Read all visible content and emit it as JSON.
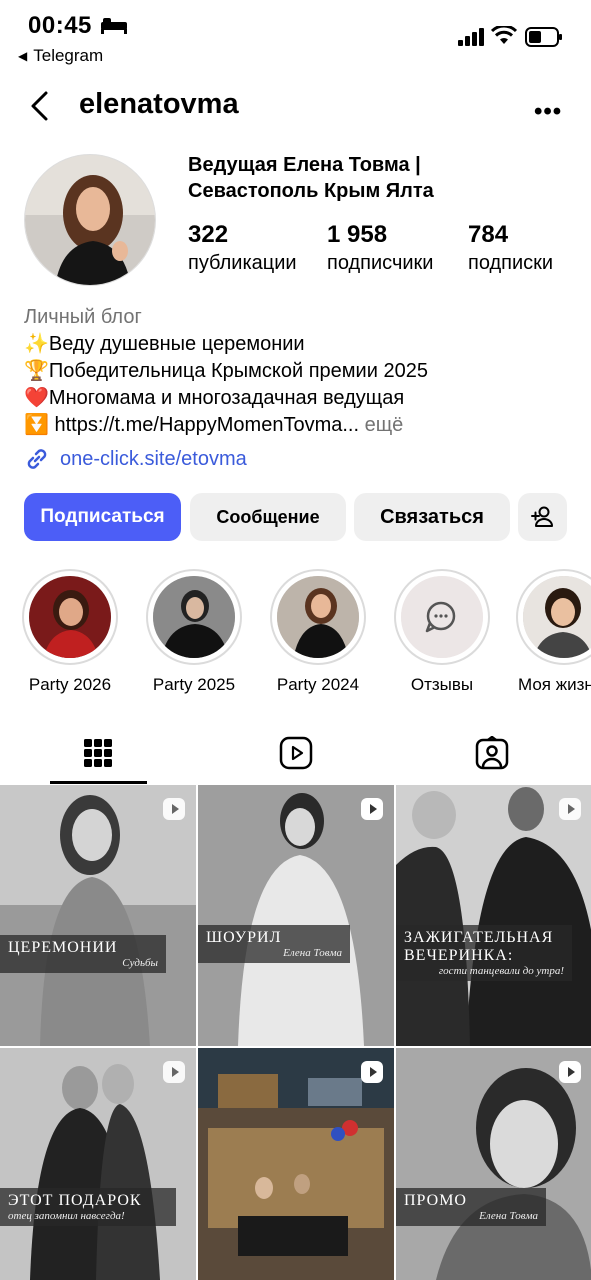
{
  "status_bar": {
    "time": "00:45",
    "back_app": "Telegram"
  },
  "header": {
    "username": "elenatovma",
    "more_icon": "more-horizontal-icon"
  },
  "profile": {
    "display_name_line1": "Ведущая Елена Товма |",
    "display_name_line2": "Севастополь Крым Ялта",
    "stats": [
      {
        "value": "322",
        "label": "публикации"
      },
      {
        "value": "1 958",
        "label": "подписчики"
      },
      {
        "value": "784",
        "label": "подписки"
      }
    ],
    "category": "Личный блог",
    "bio_lines": [
      "✨Веду душевные церемонии",
      "🏆Победительница Крымской премии 2025",
      "❤️Многомама и многозадачная ведущая"
    ],
    "bio_link_line": "⏬ https://t.me/HappyMomenTovma...",
    "bio_more": " ещё",
    "external_link": "one-click.site/etovma"
  },
  "buttons": {
    "follow": "Подписаться",
    "message": "Сообщение",
    "contact": "Связаться"
  },
  "highlights": [
    {
      "label": "Party 2026"
    },
    {
      "label": "Party 2025"
    },
    {
      "label": "Party 2024"
    },
    {
      "label": "Отзывы"
    },
    {
      "label": "Моя жизнь"
    }
  ],
  "posts": [
    {
      "caption_big": "ЦЕРЕМОНИИ",
      "caption_script": "Судьбы"
    },
    {
      "caption_big": "ШОУРИЛ",
      "caption_script": "Елена Товма"
    },
    {
      "caption_big": "ЗАЖИГАТЕЛЬНАЯ ВЕЧЕРИНКА:",
      "caption_script": "гости танцевали до утра!"
    },
    {
      "caption_big": "ЭТОТ ПОДАРОК",
      "caption_script": "отец запомнил навсегда!"
    },
    {
      "caption_big": "",
      "caption_script": ""
    },
    {
      "caption_big": "ПРОМО",
      "caption_script": "Елена Товма"
    }
  ],
  "colors": {
    "accent": "#4c5ef7",
    "link": "#3b5bdb",
    "secondary_button": "#efefef",
    "muted_text": "#737373"
  }
}
